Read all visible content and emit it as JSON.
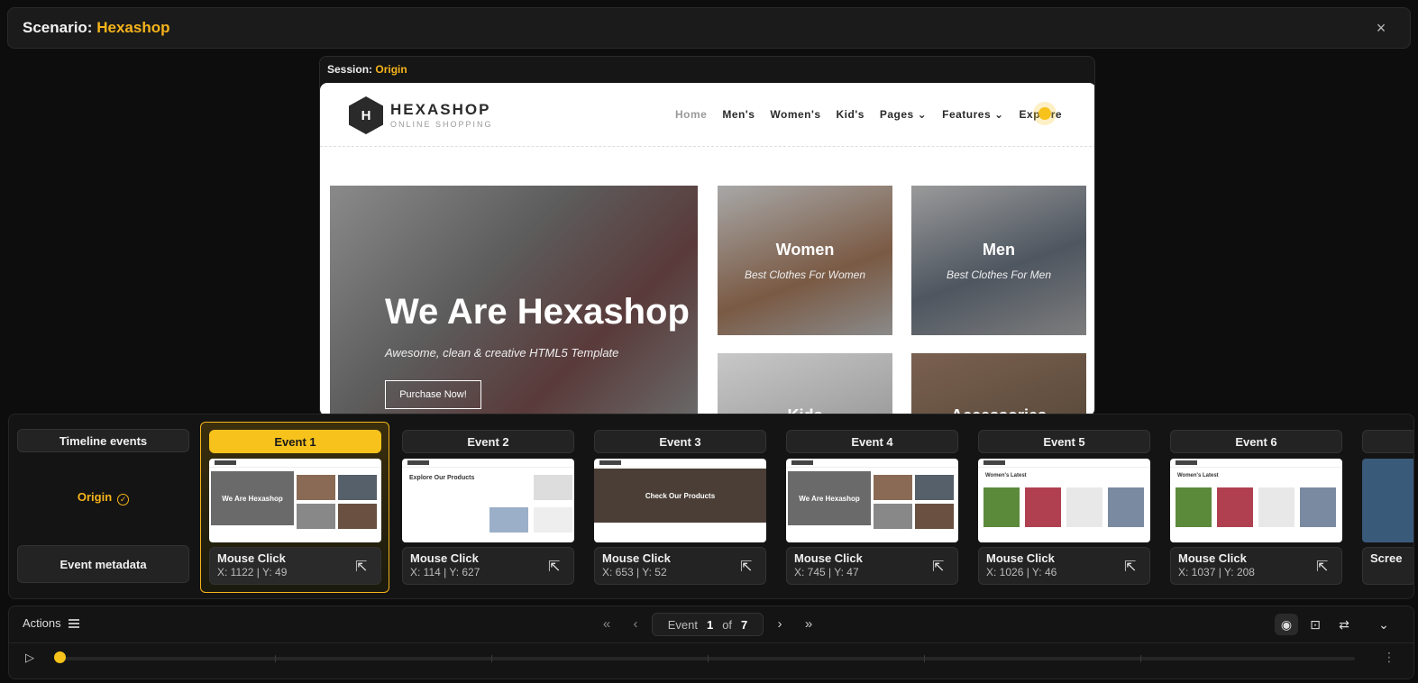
{
  "header": {
    "prefix": "Scenario:",
    "name": "Hexashop",
    "close": "×"
  },
  "session": {
    "prefix": "Session:",
    "name": "Origin"
  },
  "site": {
    "logo_mark": "H",
    "logo_name": "HEXASHOP",
    "logo_tagline": "ONLINE SHOPPING",
    "menu": [
      "Home",
      "Men's",
      "Women's",
      "Kid's",
      "Pages ⌄",
      "Features ⌄",
      "Explore"
    ],
    "hero_title": "We Are Hexashop",
    "hero_sub": "Awesome, clean & creative HTML5 Template",
    "hero_button": "Purchase Now!",
    "tiles": [
      {
        "title": "Women",
        "desc": "Best Clothes For Women"
      },
      {
        "title": "Men",
        "desc": "Best Clothes For Men"
      },
      {
        "title": "Kids",
        "desc": ""
      },
      {
        "title": "Accessories",
        "desc": ""
      }
    ]
  },
  "timeline": {
    "side_title": "Timeline events",
    "origin_label": "Origin",
    "metadata_label": "Event metadata",
    "events": [
      {
        "label": "Event 1",
        "action": "Mouse Click",
        "coords": "X: 1122 | Y: 49",
        "thumb_text": "We Are Hexashop"
      },
      {
        "label": "Event 2",
        "action": "Mouse Click",
        "coords": "X: 114 | Y: 627",
        "thumb_text": "Explore Our Products"
      },
      {
        "label": "Event 3",
        "action": "Mouse Click",
        "coords": "X: 653 | Y: 52",
        "thumb_text": "Check Our Products"
      },
      {
        "label": "Event 4",
        "action": "Mouse Click",
        "coords": "X: 745 | Y: 47",
        "thumb_text": "We Are Hexashop"
      },
      {
        "label": "Event 5",
        "action": "Mouse Click",
        "coords": "X: 1026 | Y: 46",
        "thumb_text": "Women's Latest"
      },
      {
        "label": "Event 6",
        "action": "Mouse Click",
        "coords": "X: 1037 | Y: 208",
        "thumb_text": "Women's Latest"
      }
    ],
    "partial_event_action": "Scree"
  },
  "controls": {
    "actions_label": "Actions",
    "event_word": "Event",
    "current": "1",
    "of_word": "of",
    "total": "7"
  },
  "colors": {
    "accent": "#f6b41b",
    "background": "#0d0d0d",
    "panel": "#141414"
  }
}
